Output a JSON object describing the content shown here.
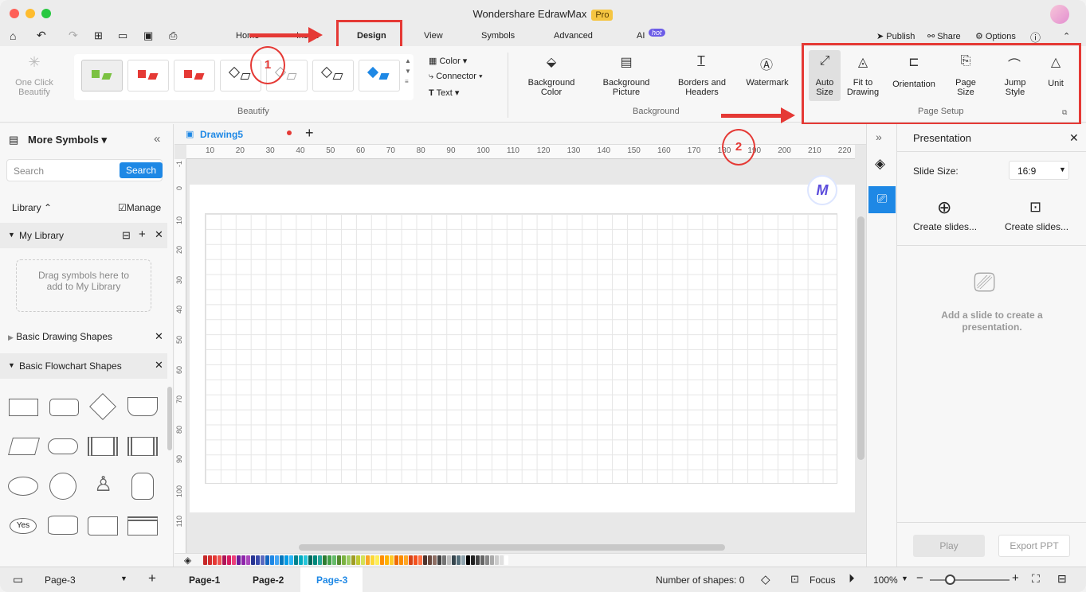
{
  "window": {
    "title": "Wondershare EdrawMax",
    "badge": "Pro"
  },
  "menu": {
    "home": "Home",
    "insert": "Insert",
    "design": "Design",
    "view": "View",
    "symbols": "Symbols",
    "advanced": "Advanced",
    "ai": "AI",
    "ai_badge": "hot",
    "publish": "Publish",
    "share": "Share",
    "options": "Options"
  },
  "ribbon": {
    "one_click": "One Click\nBeautify",
    "beautify_group": "Beautify",
    "color": "Color",
    "connector": "Connector",
    "text": "Text",
    "background_color": "Background Color",
    "background_picture": "Background Picture",
    "borders_headers": "Borders and Headers",
    "watermark": "Watermark",
    "background_group": "Background",
    "auto_size": "Auto Size",
    "fit_drawing": "Fit to Drawing",
    "orientation": "Orientation",
    "page_size": "Page Size",
    "jump_style": "Jump Style",
    "unit": "Unit",
    "page_setup_group": "Page Setup"
  },
  "annotations": {
    "step1": "1",
    "step2": "2"
  },
  "left": {
    "title": "More Symbols",
    "search_placeholder": "Search",
    "search_btn": "Search",
    "library": "Library",
    "manage": "Manage",
    "my_library": "My Library",
    "drag_hint": "Drag symbols here to add to My Library",
    "basic_drawing": "Basic Drawing Shapes",
    "basic_flowchart": "Basic Flowchart Shapes",
    "yes_shape": "Yes"
  },
  "canvas": {
    "tab": "Drawing5",
    "ruler_h": [
      "10",
      "20",
      "30",
      "40",
      "50",
      "60",
      "70",
      "80",
      "90",
      "100",
      "110",
      "120",
      "130",
      "140",
      "150",
      "160",
      "170",
      "180",
      "190",
      "200",
      "210",
      "220"
    ],
    "ruler_v": [
      "-1",
      "0",
      "10",
      "20",
      "30",
      "40",
      "50",
      "60",
      "70",
      "80",
      "90",
      "100",
      "110"
    ]
  },
  "presentation": {
    "title": "Presentation",
    "slide_size_label": "Slide Size:",
    "slide_size": "16:9",
    "create1": "Create slides...",
    "create2": "Create slides...",
    "empty": "Add a slide to create a presentation.",
    "play": "Play",
    "export": "Export PPT"
  },
  "status": {
    "page_select": "Page-3",
    "pages": [
      "Page-1",
      "Page-2",
      "Page-3"
    ],
    "shapes": "Number of shapes: 0",
    "focus": "Focus",
    "zoom": "100%"
  },
  "palette": [
    "#c62828",
    "#d32f2f",
    "#e53935",
    "#ef5350",
    "#ad1457",
    "#d81b60",
    "#ec407a",
    "#6a1b9a",
    "#8e24aa",
    "#ab47bc",
    "#283593",
    "#3949ab",
    "#5c6bc0",
    "#1565c0",
    "#1e88e5",
    "#42a5f5",
    "#0277bd",
    "#039be5",
    "#29b6f6",
    "#00838f",
    "#00acc1",
    "#26c6da",
    "#00695c",
    "#00897b",
    "#26a69a",
    "#2e7d32",
    "#43a047",
    "#66bb6a",
    "#558b2f",
    "#7cb342",
    "#9ccc65",
    "#9e9d24",
    "#c0ca33",
    "#d4e157",
    "#f9a825",
    "#fdd835",
    "#ffee58",
    "#ff8f00",
    "#ffb300",
    "#ffca28",
    "#ef6c00",
    "#fb8c00",
    "#ffa726",
    "#d84315",
    "#f4511e",
    "#ff7043",
    "#4e342e",
    "#6d4c41",
    "#8d6e63",
    "#424242",
    "#757575",
    "#bdbdbd",
    "#37474f",
    "#546e7a",
    "#90a4ae",
    "#000000",
    "#222222",
    "#444444",
    "#666666",
    "#888888",
    "#aaaaaa",
    "#cccccc",
    "#e0e0e0",
    "#ffffff"
  ]
}
